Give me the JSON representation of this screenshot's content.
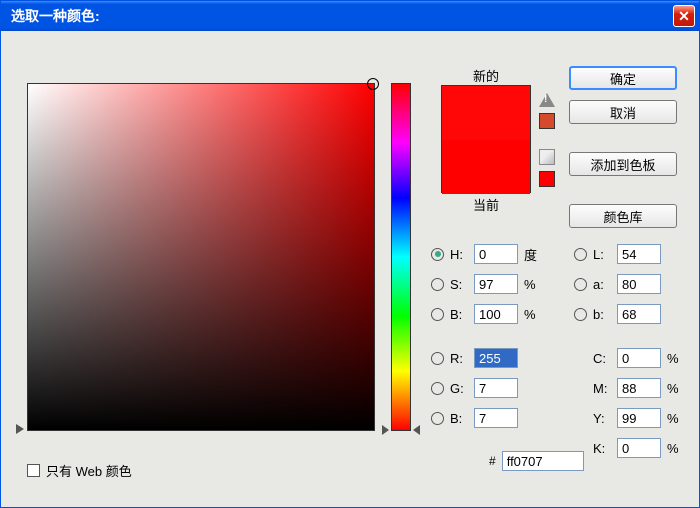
{
  "title": "选取一种颜色:",
  "labels": {
    "new": "新的",
    "current": "当前",
    "webOnly": "只有 Web 颜色",
    "degree": "度",
    "percent": "%",
    "hash": "#"
  },
  "buttons": {
    "ok": "确定",
    "cancel": "取消",
    "addSwatch": "添加到色板",
    "colorLib": "颜色库"
  },
  "preview": {
    "newColor": "#ff0707",
    "currentColor": "#ff0000",
    "warnSwatch": "#d44a2a",
    "cubeSwatch": "#ff0000"
  },
  "hsb": {
    "hLabel": "H:",
    "h": "0",
    "sLabel": "S:",
    "s": "97",
    "bLabel": "B:",
    "b": "100"
  },
  "lab": {
    "lLabel": "L:",
    "l": "54",
    "aLabel": "a:",
    "a": "80",
    "bLabel": "b:",
    "b": "68"
  },
  "rgb": {
    "rLabel": "R:",
    "r": "255",
    "gLabel": "G:",
    "g": "7",
    "bLabel": "B:",
    "b": "7"
  },
  "cmyk": {
    "cLabel": "C:",
    "c": "0",
    "mLabel": "M:",
    "m": "88",
    "yLabel": "Y:",
    "y": "99",
    "kLabel": "K:",
    "k": "0"
  },
  "hex": "ff0707",
  "selectedModel": "H"
}
